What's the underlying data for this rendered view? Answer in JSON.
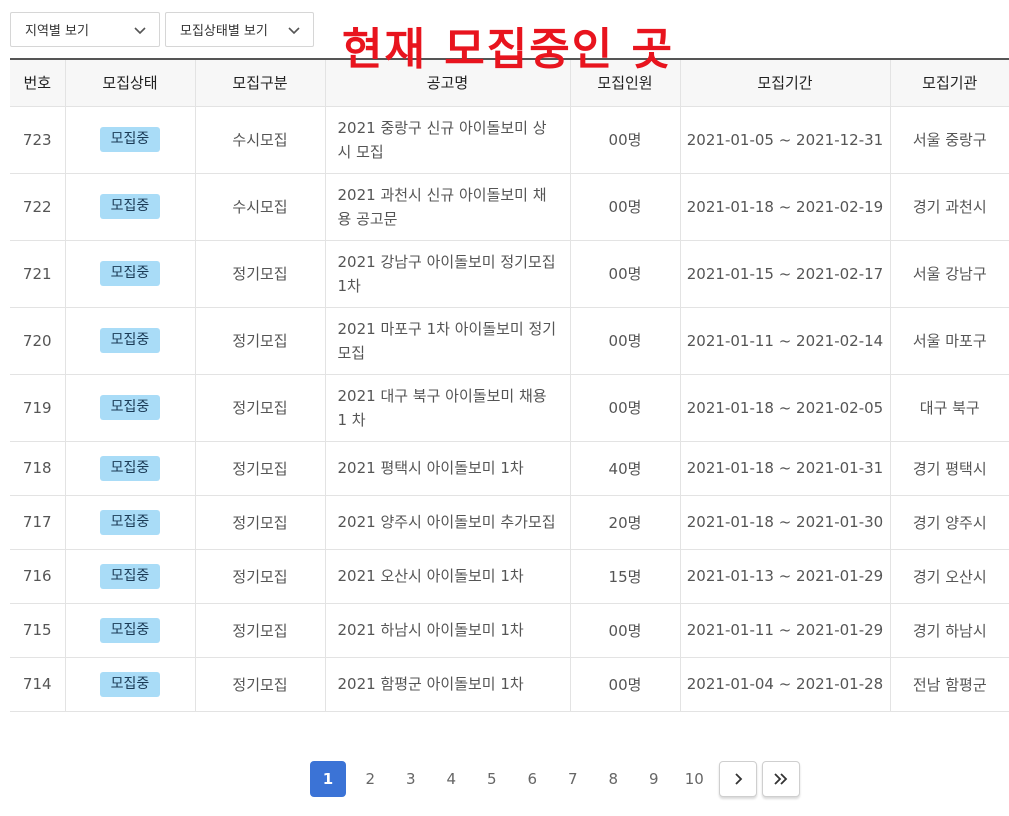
{
  "filters": {
    "region_label": "지역별 보기",
    "status_label": "모집상태별 보기"
  },
  "overlay_title": "현재 모집중인 곳",
  "table": {
    "headers": [
      "번호",
      "모집상태",
      "모집구분",
      "공고명",
      "모집인원",
      "모집기간",
      "모집기관"
    ],
    "rows": [
      {
        "no": "723",
        "status": "모집중",
        "type": "수시모집",
        "title": "2021 중랑구 신규 아이돌보미 상시 모집",
        "count": "00명",
        "period": "2021-01-05 ~ 2021-12-31",
        "agency": "서울 중랑구"
      },
      {
        "no": "722",
        "status": "모집중",
        "type": "수시모집",
        "title": "2021 과천시 신규 아이돌보미 채용 공고문",
        "count": "00명",
        "period": "2021-01-18 ~ 2021-02-19",
        "agency": "경기 과천시"
      },
      {
        "no": "721",
        "status": "모집중",
        "type": "정기모집",
        "title": "2021 강남구 아이돌보미 정기모집 1차",
        "count": "00명",
        "period": "2021-01-15 ~ 2021-02-17",
        "agency": "서울 강남구"
      },
      {
        "no": "720",
        "status": "모집중",
        "type": "정기모집",
        "title": "2021 마포구 1차 아이돌보미 정기 모집",
        "count": "00명",
        "period": "2021-01-11 ~ 2021-02-14",
        "agency": "서울 마포구"
      },
      {
        "no": "719",
        "status": "모집중",
        "type": "정기모집",
        "title": "2021 대구 북구 아이돌보미 채용 1 차",
        "count": "00명",
        "period": "2021-01-18 ~ 2021-02-05",
        "agency": "대구 북구"
      },
      {
        "no": "718",
        "status": "모집중",
        "type": "정기모집",
        "title": "2021 평택시 아이돌보미 1차",
        "count": "40명",
        "period": "2021-01-18 ~ 2021-01-31",
        "agency": "경기 평택시"
      },
      {
        "no": "717",
        "status": "모집중",
        "type": "정기모집",
        "title": "2021 양주시 아이돌보미 추가모집",
        "count": "20명",
        "period": "2021-01-18 ~ 2021-01-30",
        "agency": "경기 양주시"
      },
      {
        "no": "716",
        "status": "모집중",
        "type": "정기모집",
        "title": "2021 오산시 아이돌보미 1차",
        "count": "15명",
        "period": "2021-01-13 ~ 2021-01-29",
        "agency": "경기 오산시"
      },
      {
        "no": "715",
        "status": "모집중",
        "type": "정기모집",
        "title": "2021 하남시 아이돌보미 1차",
        "count": "00명",
        "period": "2021-01-11 ~ 2021-01-29",
        "agency": "경기 하남시"
      },
      {
        "no": "714",
        "status": "모집중",
        "type": "정기모집",
        "title": "2021 함평군 아이돌보미 1차",
        "count": "00명",
        "period": "2021-01-04 ~ 2021-01-28",
        "agency": "전남 함평군"
      }
    ]
  },
  "pagination": {
    "pages": [
      "1",
      "2",
      "3",
      "4",
      "5",
      "6",
      "7",
      "8",
      "9",
      "10"
    ],
    "current": "1",
    "next_icon": "chevron-right-icon",
    "last_icon": "double-chevron-right-icon"
  },
  "colors": {
    "accent": "#3b73d6",
    "badge_bg": "#a9dcf7",
    "overlay_red": "#e8141e"
  }
}
